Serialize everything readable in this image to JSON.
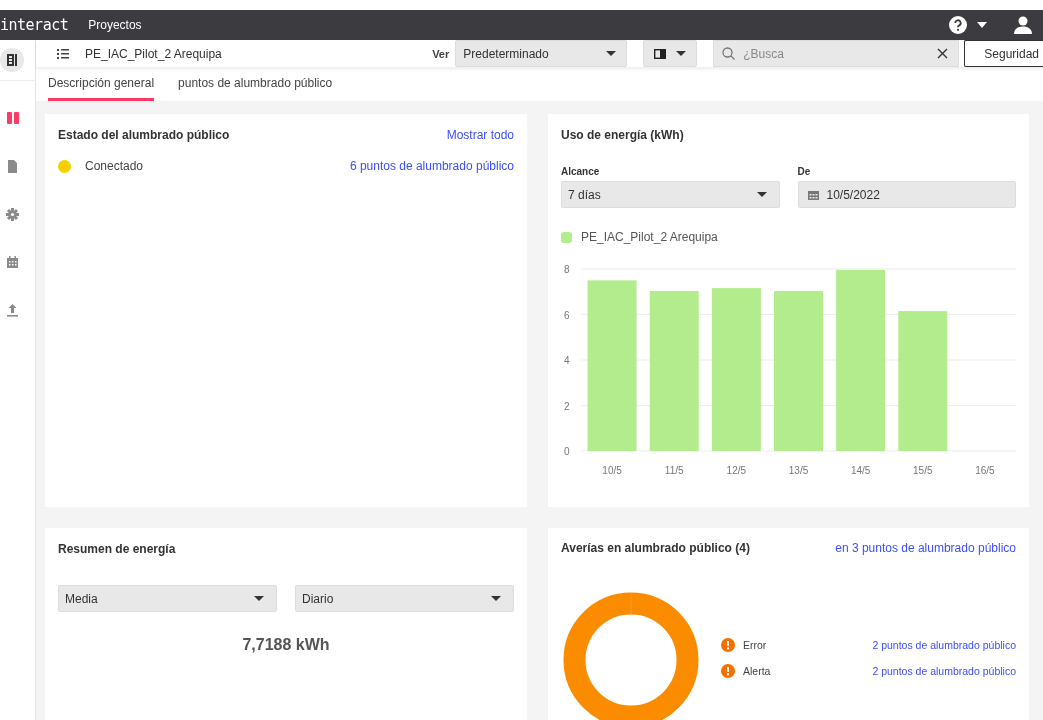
{
  "header": {
    "logo": "interact",
    "nav": "Proyectos"
  },
  "sidebar": {
    "items": [
      {
        "selected": true
      },
      {
        "selected": false
      },
      {
        "selected": false
      },
      {
        "selected": false
      },
      {
        "selected": false
      }
    ]
  },
  "toolbar": {
    "title": "PE_IAC_Pilot_2 Arequipa",
    "view_label": "Ver",
    "view_select": "Predeterminado",
    "search": {
      "placeholder": "¿Busca"
    },
    "button": "Seguridad"
  },
  "tabs": [
    {
      "label": "Descripción general",
      "selected": true
    },
    {
      "label": "puntos de alumbrado público",
      "selected": false
    }
  ],
  "status_card": {
    "title": "Estado del alumbrado público",
    "link": "Mostrar todo",
    "rows": [
      {
        "label": "Conectado",
        "color": "#f5d000",
        "link": "6 puntos de alumbrado público"
      }
    ]
  },
  "energy_card": {
    "title": "Uso de energía (kWh)",
    "range_label": "Alcance",
    "range_value": "7 días",
    "from_label": "De",
    "from_value": "10/5/2022",
    "chart_data": {
      "type": "bar",
      "categories": [
        "10/5",
        "11/5",
        "12/5",
        "13/5",
        "14/5",
        "15/5",
        "16/5"
      ],
      "series": [
        {
          "name": "PE_IAC_Pilot_2 Arequipa",
          "color": "#b2ec8c",
          "values": [
            7.5,
            7.03,
            7.16,
            7.03,
            7.96,
            6.15,
            null
          ]
        }
      ],
      "ylim": [
        0,
        8
      ],
      "yticks": [
        0,
        2,
        4,
        6,
        8
      ],
      "grid": true
    }
  },
  "summary_card": {
    "title": "Resumen de energía",
    "selects": [
      "Media",
      "Diario"
    ],
    "total": "7,7188 kWh"
  },
  "faults_card": {
    "title": "Averías en alumbrado público (4)",
    "link": "en 3 puntos de alumbrado público",
    "legend": [
      {
        "label": "Error",
        "link": "2 puntos de alumbrado público"
      },
      {
        "label": "Alerta",
        "link": "2 puntos de alumbrado público"
      }
    ]
  }
}
